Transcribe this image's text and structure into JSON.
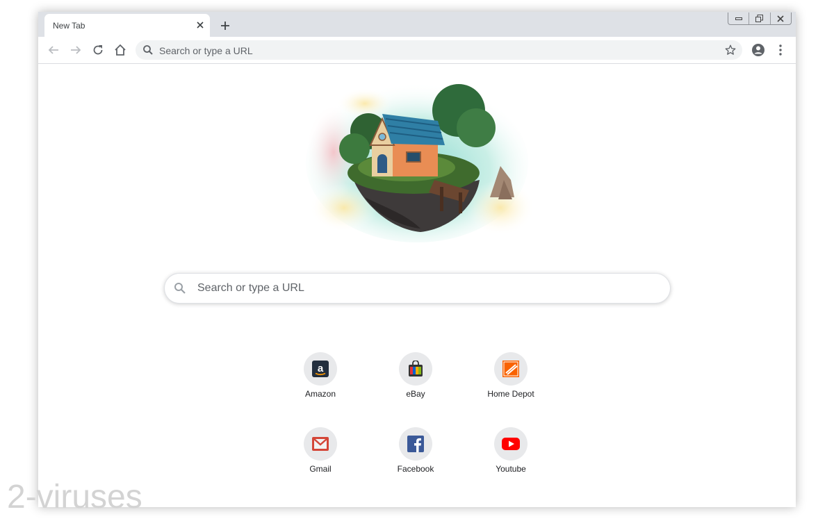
{
  "tab": {
    "title": "New Tab"
  },
  "toolbar": {
    "omnibox_placeholder": "Search or type a URL"
  },
  "icons": {
    "back": "arrow-left-icon",
    "forward": "arrow-right-icon",
    "reload": "reload-icon",
    "home": "home-icon",
    "star": "star-icon",
    "profile": "account-circle-icon",
    "menu": "kebab-menu-icon"
  },
  "main": {
    "search_placeholder": "Search or type a URL",
    "shortcuts": [
      {
        "label": "Amazon",
        "icon": "amazon-icon"
      },
      {
        "label": "eBay",
        "icon": "ebay-icon"
      },
      {
        "label": "Home Depot",
        "icon": "home-depot-icon"
      },
      {
        "label": "Gmail",
        "icon": "gmail-icon"
      },
      {
        "label": "Facebook",
        "icon": "facebook-icon"
      },
      {
        "label": "Youtube",
        "icon": "youtube-icon"
      }
    ]
  },
  "watermark": "2-viruses",
  "colors": {
    "tabstrip": "#dee1e6",
    "omnibox": "#f1f3f4",
    "home_depot": "#f96302",
    "gmail": "#d44638",
    "facebook": "#3b5998",
    "youtube": "#ff0000"
  }
}
